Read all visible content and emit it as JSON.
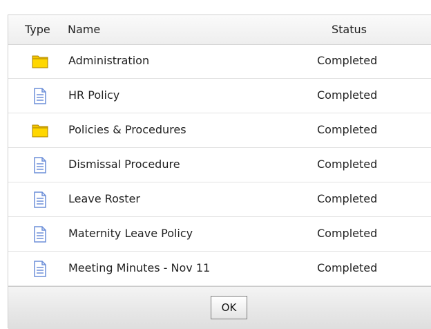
{
  "table": {
    "columns": {
      "type": "Type",
      "name": "Name",
      "status": "Status"
    },
    "rows": [
      {
        "icon": "folder-icon",
        "name": "Administration",
        "status": "Completed"
      },
      {
        "icon": "document-icon",
        "name": "HR Policy",
        "status": "Completed"
      },
      {
        "icon": "folder-icon",
        "name": "Policies & Procedures",
        "status": "Completed"
      },
      {
        "icon": "document-icon",
        "name": "Dismissal Procedure",
        "status": "Completed"
      },
      {
        "icon": "document-icon",
        "name": "Leave Roster",
        "status": "Completed"
      },
      {
        "icon": "document-icon",
        "name": "Maternity Leave Policy",
        "status": "Completed"
      },
      {
        "icon": "document-icon",
        "name": "Meeting Minutes - Nov 11",
        "status": "Completed"
      }
    ]
  },
  "footer": {
    "ok_label": "OK"
  },
  "colors": {
    "folder": "#f6c600",
    "document": "#6d8fd9"
  }
}
